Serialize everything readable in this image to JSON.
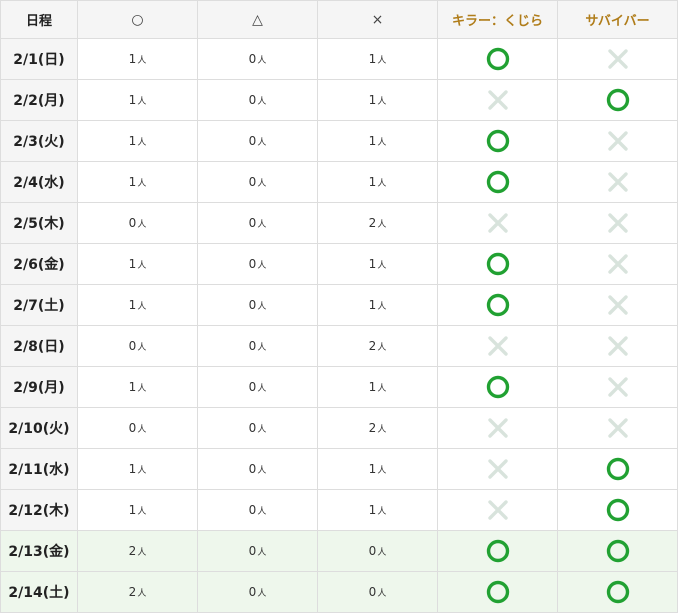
{
  "header": {
    "date_col": "日程",
    "symbols": [
      "○",
      "△",
      "×"
    ],
    "killer": "キラー：くじら",
    "survivor": "サバイバー"
  },
  "unit": "人",
  "colors": {
    "ok": "#21a132",
    "ng": "#d8e3dc",
    "role_header": "#b07d1a",
    "highlight_row": "#eef7ec"
  },
  "rows": [
    {
      "date": "2/1(日)",
      "ok": "1",
      "maybe": "0",
      "ng": "1",
      "killer": "ok",
      "survivor": "ng",
      "highlight": false
    },
    {
      "date": "2/2(月)",
      "ok": "1",
      "maybe": "0",
      "ng": "1",
      "killer": "ng",
      "survivor": "ok",
      "highlight": false
    },
    {
      "date": "2/3(火)",
      "ok": "1",
      "maybe": "0",
      "ng": "1",
      "killer": "ok",
      "survivor": "ng",
      "highlight": false
    },
    {
      "date": "2/4(水)",
      "ok": "1",
      "maybe": "0",
      "ng": "1",
      "killer": "ok",
      "survivor": "ng",
      "highlight": false
    },
    {
      "date": "2/5(木)",
      "ok": "0",
      "maybe": "0",
      "ng": "2",
      "killer": "ng",
      "survivor": "ng",
      "highlight": false
    },
    {
      "date": "2/6(金)",
      "ok": "1",
      "maybe": "0",
      "ng": "1",
      "killer": "ok",
      "survivor": "ng",
      "highlight": false
    },
    {
      "date": "2/7(土)",
      "ok": "1",
      "maybe": "0",
      "ng": "1",
      "killer": "ok",
      "survivor": "ng",
      "highlight": false
    },
    {
      "date": "2/8(日)",
      "ok": "0",
      "maybe": "0",
      "ng": "2",
      "killer": "ng",
      "survivor": "ng",
      "highlight": false
    },
    {
      "date": "2/9(月)",
      "ok": "1",
      "maybe": "0",
      "ng": "1",
      "killer": "ok",
      "survivor": "ng",
      "highlight": false
    },
    {
      "date": "2/10(火)",
      "ok": "0",
      "maybe": "0",
      "ng": "2",
      "killer": "ng",
      "survivor": "ng",
      "highlight": false
    },
    {
      "date": "2/11(水)",
      "ok": "1",
      "maybe": "0",
      "ng": "1",
      "killer": "ng",
      "survivor": "ok",
      "highlight": false
    },
    {
      "date": "2/12(木)",
      "ok": "1",
      "maybe": "0",
      "ng": "1",
      "killer": "ng",
      "survivor": "ok",
      "highlight": false
    },
    {
      "date": "2/13(金)",
      "ok": "2",
      "maybe": "0",
      "ng": "0",
      "killer": "ok",
      "survivor": "ok",
      "highlight": true
    },
    {
      "date": "2/14(土)",
      "ok": "2",
      "maybe": "0",
      "ng": "0",
      "killer": "ok",
      "survivor": "ok",
      "highlight": true
    }
  ]
}
